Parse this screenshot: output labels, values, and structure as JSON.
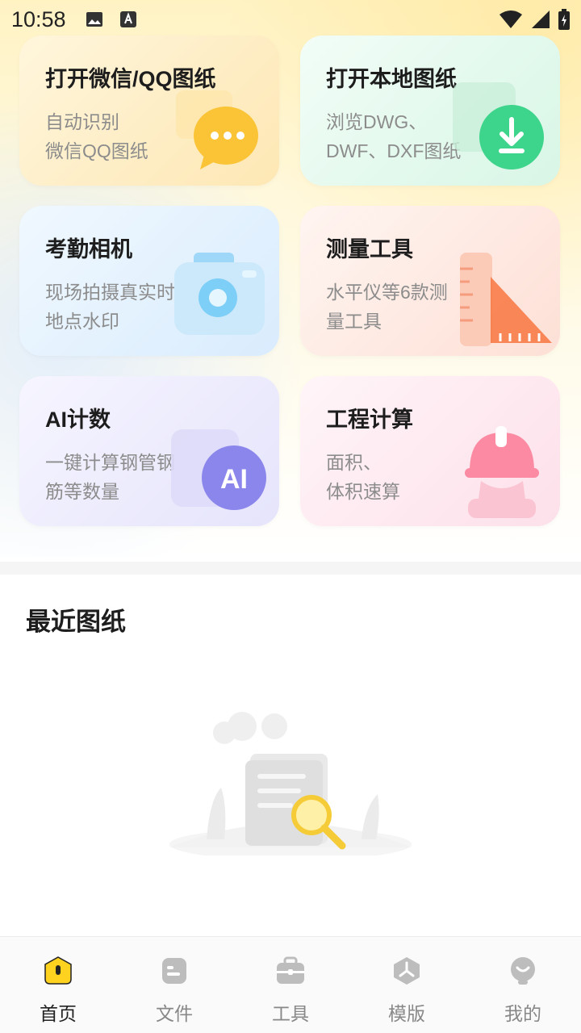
{
  "status_bar": {
    "time": "10:58"
  },
  "cards": [
    {
      "title": "打开微信/QQ图纸",
      "subtitle": "自动识别\n微信QQ图纸",
      "icon": "chat-bubble-icon"
    },
    {
      "title": "打开本地图纸",
      "subtitle": "浏览DWG、\nDWF、DXF图纸",
      "icon": "download-icon"
    },
    {
      "title": "考勤相机",
      "subtitle": "现场拍摄真实时间\n地点水印",
      "icon": "camera-icon"
    },
    {
      "title": "测量工具",
      "subtitle": "水平仪等6款测\n量工具",
      "icon": "ruler-icon"
    },
    {
      "title": "AI计数",
      "subtitle": "一键计算钢管钢\n筋等数量",
      "icon": "ai-icon",
      "badge": "AI"
    },
    {
      "title": "工程计算",
      "subtitle": "面积、\n体积速算",
      "icon": "helmet-icon"
    }
  ],
  "recent": {
    "title": "最近图纸"
  },
  "nav": {
    "items": [
      {
        "label": "首页",
        "icon": "home-icon",
        "active": true
      },
      {
        "label": "文件",
        "icon": "file-icon"
      },
      {
        "label": "工具",
        "icon": "toolbox-icon"
      },
      {
        "label": "模版",
        "icon": "template-icon"
      },
      {
        "label": "我的",
        "icon": "profile-icon"
      }
    ]
  },
  "colors": {
    "accent": "#FFD21F",
    "nav_inactive": "#888888",
    "nav_active": "#222222"
  }
}
